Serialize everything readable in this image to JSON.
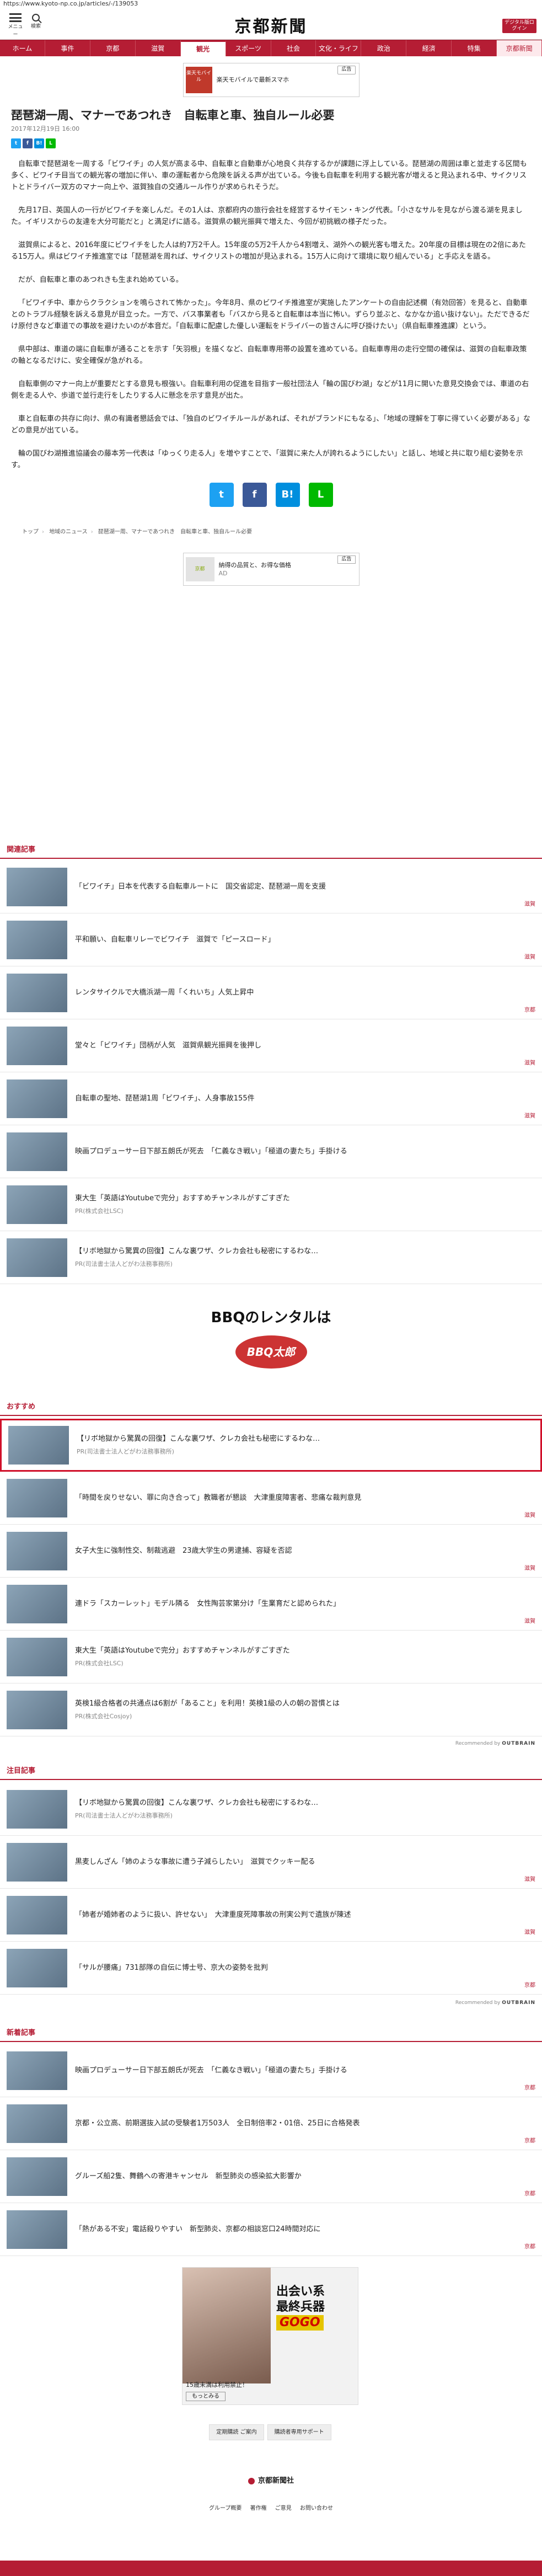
{
  "browser": {
    "url": "https://www.kyoto-np.co.jp/articles/-/139053"
  },
  "header": {
    "menu_label": "メニュー",
    "search_label": "検索",
    "logo": "京都新聞",
    "digital_label": "デジタル版ログイン"
  },
  "nav": [
    "ホーム",
    "事件",
    "京都",
    "滋賀",
    "観光",
    "スポーツ",
    "社会",
    "文化・ライフ",
    "政治",
    "経済",
    "特集",
    "京都新聞"
  ],
  "ad_top": {
    "text": "楽天モバイルで最新スマホ",
    "sub": "楽天モバイル",
    "badge": "広告"
  },
  "article": {
    "title": "琵琶湖一周、マナーであつれき　自転車と車、独自ルール必要",
    "date": "2017年12月19日 16:00",
    "paragraphs": [
      "自転車で琵琶湖を一周する「ビワイチ」の人気が高まる中、自転車と自動車が心地良く共存するかが課題に浮上している。琵琶湖の周囲は車と並走する区間も多く、ビワイチ目当ての観光客の増加に伴い、車の運転者から危険を訴える声が出ている。今後も自転車を利用する観光客が増えると見込まれる中、サイクリストとドライバー双方のマナー向上や、滋賀独自の交通ルール作りが求められそうだ。",
      "先月17日、英国人の一行がビワイチを楽しんだ。その1人は、京都府内の旅行会社を経営するサイモン・キング代表。「小さなサルを見ながら渡る湖を見ました。イギリスからの友達を大分可能だと」と満足げに語る。滋賀県の観光振興で増えた、今回が初挑戦の様子だった。",
      "滋賀県によると、2016年度にビワイチをした人は約7万2千人。15年度の5万2千人から4割増え、湖外への観光客も増えた。20年度の目標は現在の2倍にあたる15万人。県はビワイチ推進室では「琵琶湖を周れば、サイクリストの増加が見込まれる。15万人に向けて環境に取り組んでいる」と手応えを語る。",
      "だが、自転車と車のあつれきも生まれ始めている。",
      "「ビワイチ中、車からクラクションを鳴らされて怖かった」。今年8月、県のビワイチ推進室が実施したアンケートの自由記述欄（有効回答）を見ると、自動車とのトラブル経験を訴える意見が目立った。一方で、バス事業者も「バスから見ると自転車は本当に怖い。ずらり並ぶと、なかなか追い抜けない」。ただできるだけ原付きなど車道での事故を避けたいのが本音だ。「自転車に配慮した優しい運転をドライバーの皆さんに呼び掛けたい」（県自転車推進課）という。",
      "県中部は、車道の端に自転車が通ることを示す「矢羽根」を描くなど、自転車専用帯の設置を進めている。自転車専用の走行空間の確保は、滋賀の自転車政策の軸となるだけに、安全確保が急がれる。",
      "自転車側のマナー向上が重要だとする意見も根強い。自転車利用の促進を目指す一般社団法人「輪の国びわ湖」などが11月に開いた意見交換会では、車道の右側を走る人や、歩道で並行走行をしたりする人に懸念を示す意見が出た。",
      "車と自転車の共存に向け、県の有識者懇話会では、「独自のビワイチルールがあれば、それがブランドにもなる」、「地域の理解を丁寧に得ていく必要がある」などの意見が出ている。",
      "輪の国びわ湖推進協議会の藤本芳一代表は「ゆっくり走る人」を増やすことで、「滋賀に来た人が誇れるようにしたい」と話し、地域と共に取り組む姿勢を示す。"
    ]
  },
  "breadcrumb": [
    "トップ",
    "地域のニュース",
    "琵琶湖一周、マナーであつれき　自転車と車、独自ルール必要"
  ],
  "ad_mid": {
    "thumb": "京都",
    "text": "納得の品質と、お得な価格",
    "sub": "AD",
    "badge": "広告"
  },
  "sections": {
    "related": {
      "title": "関連記事",
      "items": [
        {
          "text": "「ビワイチ」日本を代表する自転車ルートに　国交省認定、琵琶湖一周を支援",
          "cat": "滋賀"
        },
        {
          "text": "平和願い、自転車リレーでビワイチ　滋賀で「ピースロード」",
          "cat": "滋賀"
        },
        {
          "text": "レンタサイクルで大橋浜湖一周「くれいち」人気上昇中",
          "cat": "京都"
        },
        {
          "text": "堂々と「ビワイチ」団柄が人気　滋賀県観光振興を後押し",
          "cat": "滋賀"
        },
        {
          "text": "自転車の聖地、琵琶湖1周「ビワイチ」、人身事故155件",
          "cat": "滋賀"
        },
        {
          "text": "映画プロデューサー日下部五朗氏が死去　「仁義なき戦い」「極道の妻たち」手掛ける",
          "cat": ""
        },
        {
          "text": "東大生「英語はYoutubeで完分」おすすめチャンネルがすごすぎた",
          "sub": "PR(株式会社LSC)",
          "cat": ""
        },
        {
          "text": "【リボ地獄から驚異の回復】こんな裏ワザ、クレカ会社も秘密にするわな…",
          "sub": "PR(司法書士法人どがわ法務事務所)",
          "cat": ""
        }
      ]
    },
    "recommend": {
      "title": "おすすめ",
      "items": [
        {
          "text": "【リボ地獄から驚異の回復】こんな裏ワザ、クレカ会社も秘密にするわな…",
          "sub": "PR(司法書士法人どがわ法務事務所)",
          "cat": ""
        },
        {
          "text": "「時間を戻りせない、罪に向き合って」教職者が懇談　大津重度障害者、悲痛な裁判意見",
          "cat": "滋賀"
        },
        {
          "text": "女子大生に強制性交、制裁逃避　23歳大学生の男逮捕、容疑を否認",
          "cat": "滋賀"
        },
        {
          "text": "連ドラ「スカーレット」モデル隣る　女性陶芸家第分け「生業育だと認められた」",
          "cat": "滋賀"
        },
        {
          "text": "東大生「英語はYoutubeで完分」おすすめチャンネルがすごすぎた",
          "sub": "PR(株式会社LSC)",
          "cat": ""
        },
        {
          "text": "英検1級合格者の共通点は6割が「あること」を利用！英検1級の人の朝の習慣とは",
          "sub": "PR(株式会社Cosjoy)",
          "cat": ""
        }
      ],
      "recommended_by": "Recommended by",
      "recommended_brand": "OUTBRAIN"
    },
    "popular": {
      "title": "注目記事",
      "items": [
        {
          "text": "【リボ地獄から驚異の回復】こんな裏ワザ、クレカ会社も秘密にするわな…",
          "sub": "PR(司法書士法人どがわ法務事務所)",
          "cat": ""
        },
        {
          "text": "黒麦しんざん「姉のような事故に遭う子減らしたい」　滋賀でクッキー配る",
          "cat": "滋賀"
        },
        {
          "text": "「姉者が婚姉者のように扱い、許せない」　大津重度死障事故の刑実公判で遺族が陳述",
          "cat": "滋賀"
        },
        {
          "text": "「サルが腰痛」731部隊の自伝に博士号、京大の姿勢を批判",
          "cat": "京都"
        }
      ],
      "recommended_by": "Recommended by",
      "recommended_brand": "OUTBRAIN"
    },
    "latest": {
      "title": "新着記事",
      "items": [
        {
          "text": "映画プロデューサー日下部五朗氏が死去　「仁義なき戦い」「極道の妻たち」手掛ける",
          "cat": "京都"
        },
        {
          "text": "京都・公立高、前期選抜入試の受験者1万503人　全日制倍率2・01倍、25日に合格発表",
          "cat": "京都"
        },
        {
          "text": "グルーズ船2隻、舞鶴への寄港キャンセル　新型肺炎の感染拡大影響か",
          "cat": "京都"
        },
        {
          "text": "「熱がある不安」電話殺りやすい　新型肺炎、京都の相談窓口24時間対応に",
          "cat": "京都"
        }
      ]
    }
  },
  "bbq_ad": {
    "title": "BBQのレンタルは",
    "brand": "BBQ太郎"
  },
  "banner_ad": {
    "line1": "出会い系",
    "line2": "最終兵器",
    "gogo": "GOGO",
    "caption": "15歳未満は利用禁止！",
    "more": "もっとみる"
  },
  "bottom_buttons": [
    "定期購読 ご案内",
    "購読者専用サポート"
  ],
  "footer": {
    "logo": "京都新聞社",
    "links": [
      "グループ概要",
      "著作権",
      "ご意見",
      "お問い合わせ"
    ]
  }
}
